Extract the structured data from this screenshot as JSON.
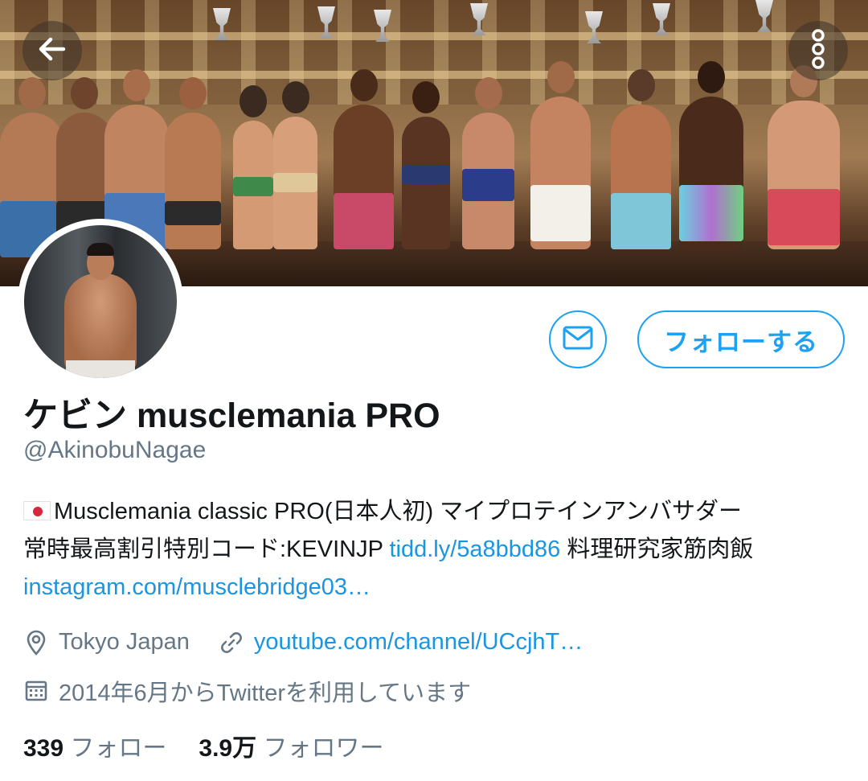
{
  "header": {
    "back_icon": "arrow-left-icon",
    "more_icon": "vertical-dots-icon"
  },
  "banner": {
    "description_colors": {
      "stage": "#5a3c26",
      "trophy": "#c9c9c9"
    }
  },
  "profile": {
    "display_name": "ケビン musclemania PRO",
    "handle": "@AkinobuNagae",
    "follow_label": "フォローする",
    "message_icon": "envelope-icon"
  },
  "bio": {
    "line1_text": "Musclemania classic PRO(日本人初) マイプロテインアンバサダー",
    "line2_prefix": "常時最高割引特別コード:KEVINJP ",
    "line2_link": "tidd.ly/5a8bbd86",
    "line2_suffix": " 料理研究家筋肉飯",
    "line3_link": "instagram.com/musclebridge03…"
  },
  "meta": {
    "location": "Tokyo Japan",
    "website": "youtube.com/channel/UCcjhT…",
    "joined": "2014年6月からTwitterを利用しています"
  },
  "stats": {
    "following_count": "339",
    "following_label": "フォロー",
    "followers_count": "3.9万",
    "followers_label": "フォロワー"
  },
  "colors": {
    "accent": "#1da1f2",
    "link": "#1b95e0",
    "secondary_text": "#657786",
    "primary_text": "#14171a"
  }
}
